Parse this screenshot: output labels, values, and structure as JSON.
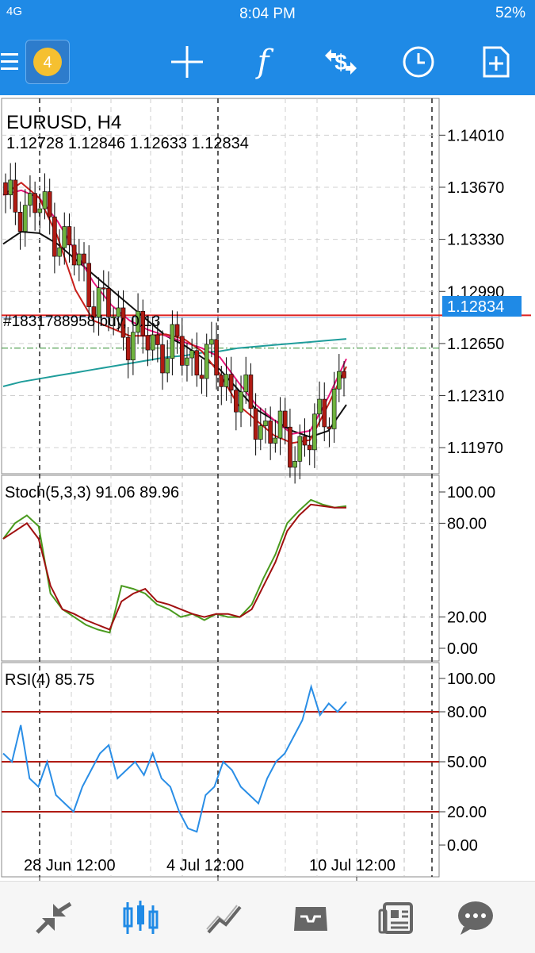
{
  "status": {
    "signal": "4G",
    "time": "8:04 PM",
    "battery": "52%"
  },
  "toolbar": {
    "icons": [
      "menu-icon",
      "metatrader-logo",
      "crosshair-icon",
      "indicators-icon",
      "trade-icon",
      "period-icon",
      "new-order-icon"
    ],
    "indicator_label": "f"
  },
  "chart": {
    "symbol": "EURUSD, H4",
    "ohlc": "1.12728 1.12846 1.12633 1.12834",
    "price_ticks": [
      "1.14010",
      "1.13670",
      "1.13330",
      "1.12990",
      "1.12650",
      "1.12310",
      "1.11970"
    ],
    "current_price": "1.12834",
    "order_label": "#1831788958 buy, 0.13",
    "stoch_label": "Stoch(5,3,3) 91.06 89.96",
    "stoch_ticks": [
      "100.00",
      "80.00",
      "20.00",
      "0.00"
    ],
    "rsi_label": "RSI(4) 85.75",
    "rsi_ticks": [
      "100.00",
      "80.00",
      "50.00",
      "20.00",
      "0.00"
    ],
    "time_labels": [
      "28 Jun 12:00",
      "4 Jul 12:00",
      "10 Jul 12:00"
    ]
  },
  "colors": {
    "brand": "#1f8ae6",
    "bull": "#6fb33e",
    "bear": "#b01b13",
    "ma_black": "#111111",
    "ma_pink": "#e8167a",
    "ma_red": "#c8201c",
    "ma_teal": "#1f9d9b",
    "rsi": "#2a8ee6",
    "stoch_main": "#4a9a1e",
    "stoch_signal": "#a01010"
  },
  "bottom_nav": [
    "quotes-icon",
    "chart-icon",
    "trade-icon",
    "history-icon",
    "news-icon",
    "chat-icon"
  ],
  "chart_data": {
    "type": "line",
    "price_range": [
      1.118,
      1.1425
    ],
    "ma_pink": [
      1.1362,
      1.1365,
      1.136,
      1.1345,
      1.1325,
      1.1305,
      1.129,
      1.128,
      1.1274,
      1.127,
      1.1266,
      1.1262,
      1.1256,
      1.124,
      1.1225,
      1.1215,
      1.1206,
      1.1208,
      1.123,
      1.1255
    ],
    "ma_red": [
      1.1362,
      1.137,
      1.136,
      1.1335,
      1.13,
      1.128,
      1.1275,
      1.127,
      1.127,
      1.1271,
      1.1268,
      1.126,
      1.1245,
      1.1225,
      1.1215,
      1.1205,
      1.12,
      1.1202,
      1.1225,
      1.125
    ],
    "ma_black": [
      1.133,
      1.1338,
      1.1337,
      1.133,
      1.132,
      1.131,
      1.13,
      1.129,
      1.128,
      1.127,
      1.1264,
      1.1256,
      1.1248,
      1.1235,
      1.1222,
      1.1215,
      1.1208,
      1.1204,
      1.1208,
      1.1225
    ],
    "ma_teal": [
      1.1237,
      1.124,
      1.1242,
      1.1244,
      1.1246,
      1.1248,
      1.125,
      1.1252,
      1.1254,
      1.1256,
      1.1257,
      1.1259,
      1.126,
      1.1262,
      1.1263,
      1.1264,
      1.1265,
      1.1266,
      1.1267,
      1.1268
    ],
    "stoch_k": [
      70,
      80,
      85,
      78,
      35,
      25,
      20,
      15,
      12,
      10,
      40,
      38,
      35,
      28,
      25,
      20,
      22,
      18,
      22,
      20,
      20,
      28,
      45,
      60,
      80,
      88,
      95,
      92,
      90,
      91
    ],
    "stoch_d": [
      70,
      75,
      80,
      70,
      40,
      25,
      22,
      18,
      15,
      12,
      30,
      35,
      38,
      30,
      28,
      25,
      22,
      20,
      22,
      22,
      20,
      25,
      40,
      55,
      75,
      85,
      92,
      91,
      90,
      90
    ],
    "rsi": [
      55,
      50,
      72,
      40,
      35,
      50,
      30,
      25,
      20,
      35,
      45,
      55,
      60,
      40,
      45,
      50,
      42,
      55,
      40,
      35,
      20,
      10,
      8,
      30,
      35,
      50,
      45,
      35,
      30,
      25,
      40,
      50,
      55,
      65,
      75,
      95,
      78,
      85,
      80,
      86
    ]
  }
}
